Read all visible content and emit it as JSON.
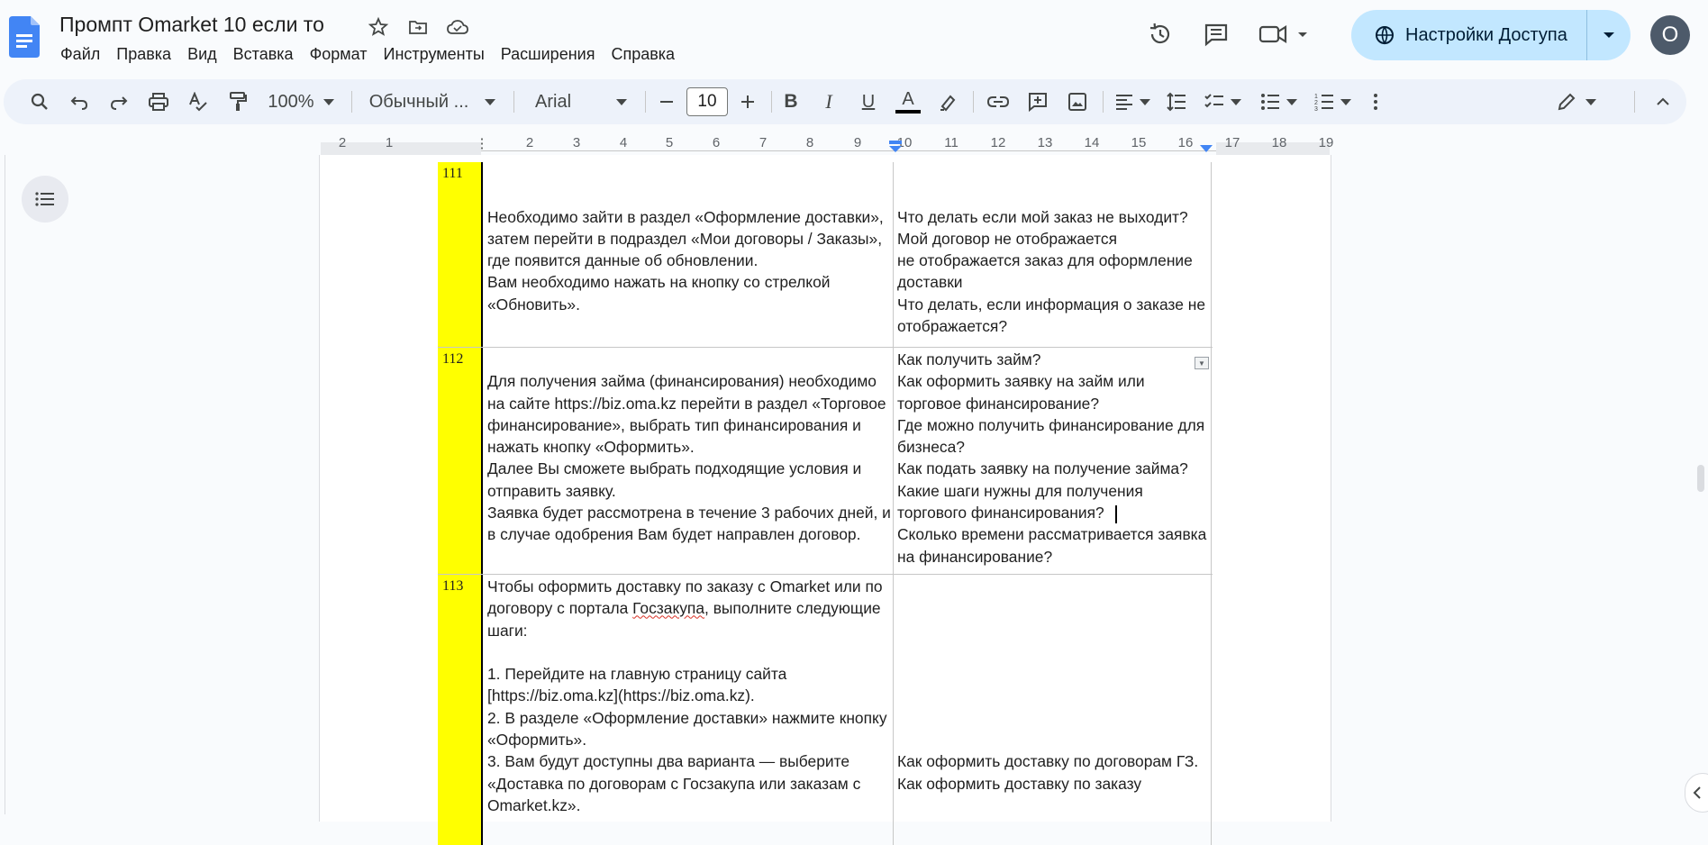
{
  "header": {
    "doc_title": "Промпт Omarket 10 если то",
    "menu": [
      "Файл",
      "Правка",
      "Вид",
      "Вставка",
      "Формат",
      "Инструменты",
      "Расширения",
      "Справка"
    ],
    "share_label": "Настройки Доступа",
    "avatar_initial": "O",
    "icons": [
      "docs-logo-icon",
      "star-icon",
      "move-folder-icon",
      "cloud-saved-icon",
      "history-icon",
      "comments-icon",
      "meet-icon"
    ]
  },
  "toolbar": {
    "zoom": "100%",
    "style": "Обычный ...",
    "font": "Arial",
    "font_size": "10",
    "bold": "B",
    "italic": "I",
    "underline": "U",
    "text_color": "A",
    "text_color_value": "#000000"
  },
  "ruler": {
    "labels": [
      "2",
      "1",
      "",
      "2",
      "3",
      "4",
      "5",
      "6",
      "7",
      "8",
      "9",
      "10",
      "11",
      "12",
      "13",
      "14",
      "15",
      "16",
      "17",
      "18",
      "19"
    ]
  },
  "table": {
    "rows": [
      {
        "num": "111",
        "answer": "\n\nНеобходимо зайти в раздел «Оформление доставки», затем перейти в подраздел «Мои договоры / Заказы», где появится данные об обновлении.\nВам необходимо нажать на кнопку со стрелкой «Обновить».",
        "questions": "\n\nЧто делать если мой заказ не выходит?\nМой договор не отображается\nне отображается заказ для оформление доставки\nЧто делать, если информация о заказе не отображается?"
      },
      {
        "num": "112",
        "answer": "\nДля получения займа (финансирования) необходимо на сайте https://biz.oma.kz перейти в раздел «Торговое финансирование», выбрать тип финансирования и нажать кнопку «Оформить».\nДалее Вы сможете выбрать подходящие условия и отправить заявку.\nЗаявка будет рассмотрена в течение 3 рабочих дней, и в случае одобрения Вам будет направлен договор.",
        "questions": "Как получить займ?\nКак оформить заявку на займ или торговое финансирование?\nГде можно получить финансирование для бизнеса?\nКак подать заявку на получение займа?\nКакие шаги нужны для получения торгового финансирования?\nСколько времени рассматривается заявка на финансирование?"
      },
      {
        "num": "113",
        "answer_before": "Чтобы оформить доставку по заказу с Omarket или по договору с портала ",
        "answer_misspelled": "Госзакупа",
        "answer_after": ", выполните следующие шаги:\n\n1. Перейдите на главную страницу сайта [https://biz.oma.kz](https://biz.oma.kz).\n2. В разделе «Оформление доставки» нажмите кнопку «Оформить».\n3. Вам будут доступны два варианта — выберите «Доставка по договорам с Госзакупа или заказам с Omarket.kz».",
        "questions": "\n\n\n\n\n\n\n\nКак оформить доставку по договорам ГЗ.\nКак оформить доставку по заказу"
      }
    ]
  }
}
